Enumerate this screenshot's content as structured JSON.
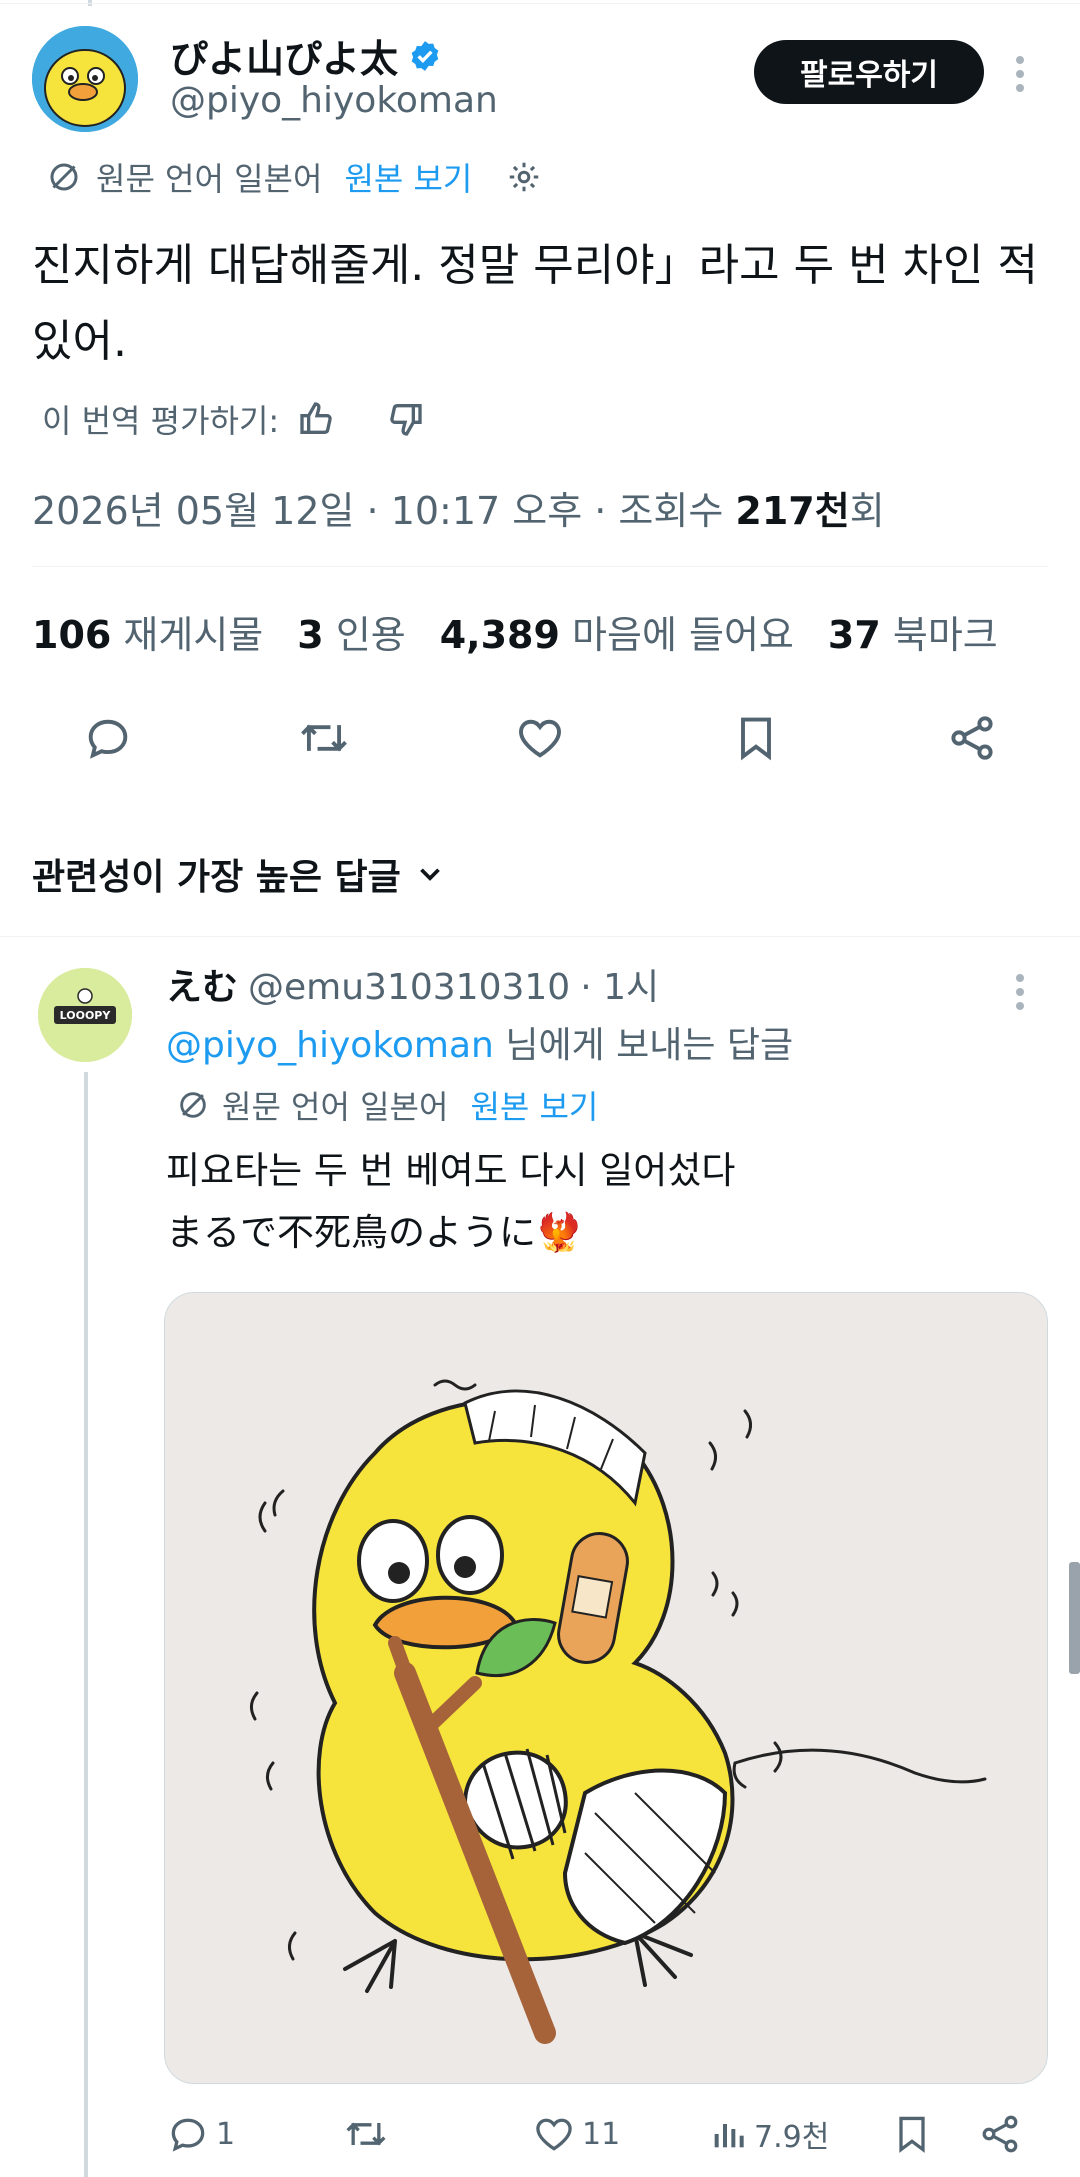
{
  "post": {
    "author_name": "ぴよ山ぴよ太",
    "handle": "@piyo_hiyokoman",
    "follow_label": "팔로우하기",
    "translation_source": "원문 언어 일본어",
    "view_original": "원본 보기",
    "text": "진지하게 대답해줄게. 정말 무리야」라고 두 번 차인 적 있어.",
    "rate_translation": "이 번역 평가하기:",
    "timestamp": "2026년 05월 12일 · 10:17 오후 · 조회수 ",
    "views_count": "217천",
    "views_suffix": "회",
    "stats": {
      "reposts_count": "106",
      "reposts_label": "재게시물",
      "quotes_count": "3",
      "quotes_label": "인용",
      "likes_count": "4,389",
      "likes_label": "마음에 들어요",
      "bookmarks_count": "37",
      "bookmarks_label": "북마크"
    },
    "replies_sort": "관련성이 가장 높은 답글"
  },
  "reply": {
    "author_name": "えむ",
    "handle": "@emu310310310",
    "time": "· 1시",
    "reply_to_handle": "@piyo_hiyokoman",
    "reply_to_suffix": " 님에게 보내는 답글",
    "translation_source": "원문 언어 일본어",
    "view_original": "원본 보기",
    "text_line1": "피요타는 두 번 베여도 다시 일어섰다",
    "text_line2": "まるで不死鳥のように",
    "text_emoji": "🐦‍🔥",
    "avatar_text": "LOOOPY",
    "actions": {
      "replies": "1",
      "likes": "11",
      "views": "7.9천"
    }
  },
  "colors": {
    "accent": "#1d9bf0",
    "text": "#0f1419",
    "muted": "#536471",
    "chick": "#f6e33b",
    "beak": "#f2a13a"
  },
  "icons": [
    "verified-badge-icon",
    "more-icon",
    "translate-icon",
    "settings-icon",
    "thumbs-up-icon",
    "thumbs-down-icon",
    "reply-icon",
    "retweet-icon",
    "heart-icon",
    "bookmark-icon",
    "share-icon",
    "chevron-down-icon",
    "views-icon"
  ]
}
